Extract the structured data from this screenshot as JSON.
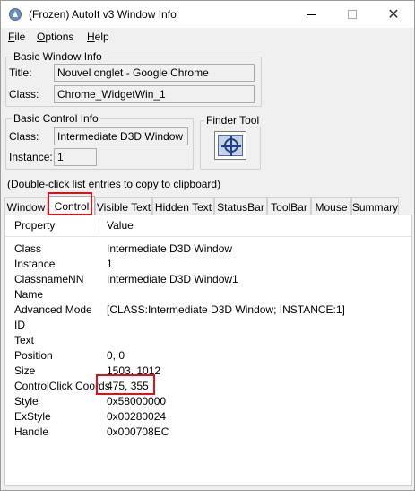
{
  "window": {
    "title": "(Frozen) AutoIt v3 Window Info"
  },
  "menu": [
    {
      "label": "File",
      "accel": "F",
      "rest": "ile"
    },
    {
      "label": "Options",
      "accel": "O",
      "rest": "ptions"
    },
    {
      "label": "Help",
      "accel": "H",
      "rest": "elp"
    }
  ],
  "basic_window": {
    "group_title": "Basic Window Info",
    "title_label": "Title:",
    "title_value": "Nouvel onglet - Google Chrome",
    "class_label": "Class:",
    "class_value": "Chrome_WidgetWin_1"
  },
  "basic_control": {
    "group_title": "Basic Control Info",
    "class_label": "Class:",
    "class_value": "Intermediate D3D Window",
    "instance_label": "Instance:",
    "instance_value": "1"
  },
  "finder_tool": {
    "group_title": "Finder Tool",
    "icon": "crosshair-icon"
  },
  "hint": "(Double-click list entries to copy to clipboard)",
  "tabs": [
    "Window",
    "Control",
    "Visible Text",
    "Hidden Text",
    "StatusBar",
    "ToolBar",
    "Mouse",
    "Summary"
  ],
  "active_tab": "Control",
  "list": {
    "headers": [
      "Property",
      "Value"
    ],
    "rows": [
      {
        "property": "Class",
        "value": "Intermediate D3D Window"
      },
      {
        "property": "Instance",
        "value": "1"
      },
      {
        "property": "ClassnameNN",
        "value": "Intermediate D3D Window1"
      },
      {
        "property": "Name",
        "value": ""
      },
      {
        "property": "Advanced Mode",
        "value": "[CLASS:Intermediate D3D Window; INSTANCE:1]"
      },
      {
        "property": "ID",
        "value": ""
      },
      {
        "property": "Text",
        "value": ""
      },
      {
        "property": "Position",
        "value": "0, 0"
      },
      {
        "property": "Size",
        "value": "1503, 1012"
      },
      {
        "property": "ControlClick Coords",
        "value": "475, 355"
      },
      {
        "property": "Style",
        "value": "0x58000000"
      },
      {
        "property": "ExStyle",
        "value": "0x00280024"
      },
      {
        "property": "Handle",
        "value": "0x000708EC"
      }
    ]
  },
  "colors": {
    "highlight": "#e0101a",
    "background": "#f0f0f0"
  }
}
